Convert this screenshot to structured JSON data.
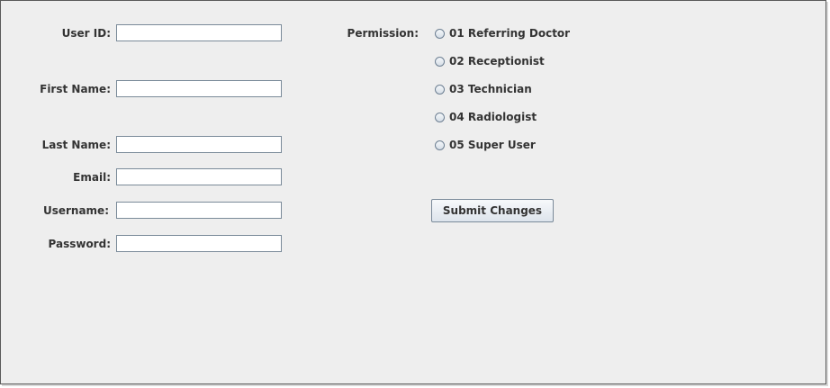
{
  "form": {
    "user_id_label": "User ID:",
    "first_name_label": "First Name:",
    "last_name_label": "Last Name:",
    "email_label": "Email:",
    "username_label": "Username:",
    "password_label": "Password:",
    "user_id_value": "",
    "first_name_value": "",
    "last_name_value": "",
    "email_value": "",
    "username_value": "",
    "password_value": ""
  },
  "permission": {
    "label": "Permission:",
    "options": [
      {
        "label": "01 Referring Doctor",
        "selected": false
      },
      {
        "label": "02 Receptionist",
        "selected": false
      },
      {
        "label": "03 Technician",
        "selected": false
      },
      {
        "label": "04 Radiologist",
        "selected": false
      },
      {
        "label": "05 Super User",
        "selected": false
      }
    ]
  },
  "actions": {
    "submit_label": "Submit Changes"
  }
}
